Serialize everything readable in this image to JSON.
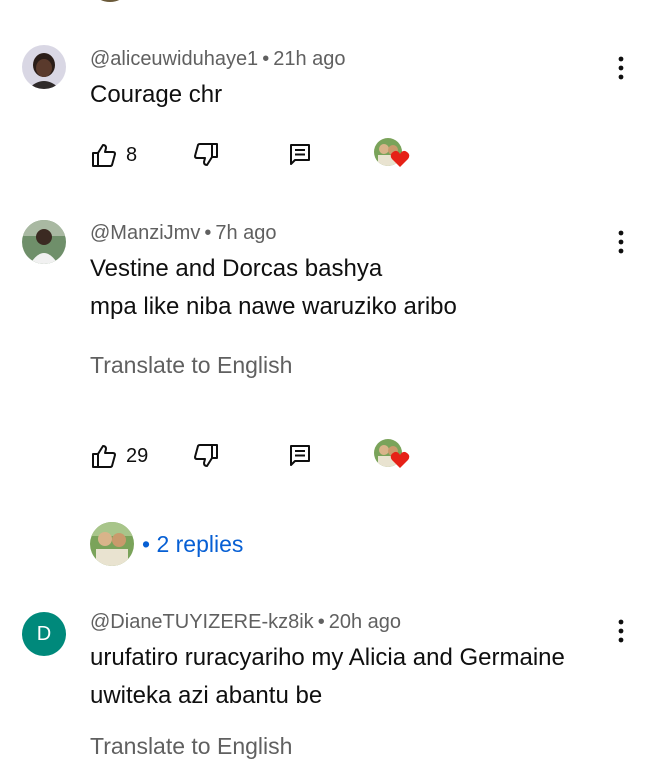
{
  "comments": [
    {
      "handle": "@aliceuwiduhaye1",
      "time": "21h ago",
      "lines": [
        "Courage chr"
      ],
      "likes": "8"
    },
    {
      "handle": "@ManziJmv",
      "time": "7h ago",
      "lines": [
        "Vestine and Dorcas bashya",
        "mpa like niba nawe waruziko aribo"
      ],
      "translate": "Translate to English",
      "likes": "29",
      "replies": "2 replies"
    },
    {
      "handle": "@DianeTUYIZERE-kz8ik",
      "time": "20h ago",
      "avatar_letter": "D",
      "lines": [
        "urufatiro ruracyariho my Alicia and Germaine",
        "uwiteka azi abantu be"
      ],
      "translate": "Translate to English"
    }
  ],
  "separator": "•",
  "icons": {
    "like": "thumb-up-icon",
    "dislike": "thumb-down-icon",
    "reply": "reply-comment-icon",
    "creator_heart": "creator-heart-icon",
    "more": "more-vertical-icon"
  },
  "colors": {
    "text": "#0f0f0f",
    "secondary": "#606060",
    "link": "#065fd4",
    "heart": "#e62117",
    "letter_avatar": "#00897b"
  }
}
